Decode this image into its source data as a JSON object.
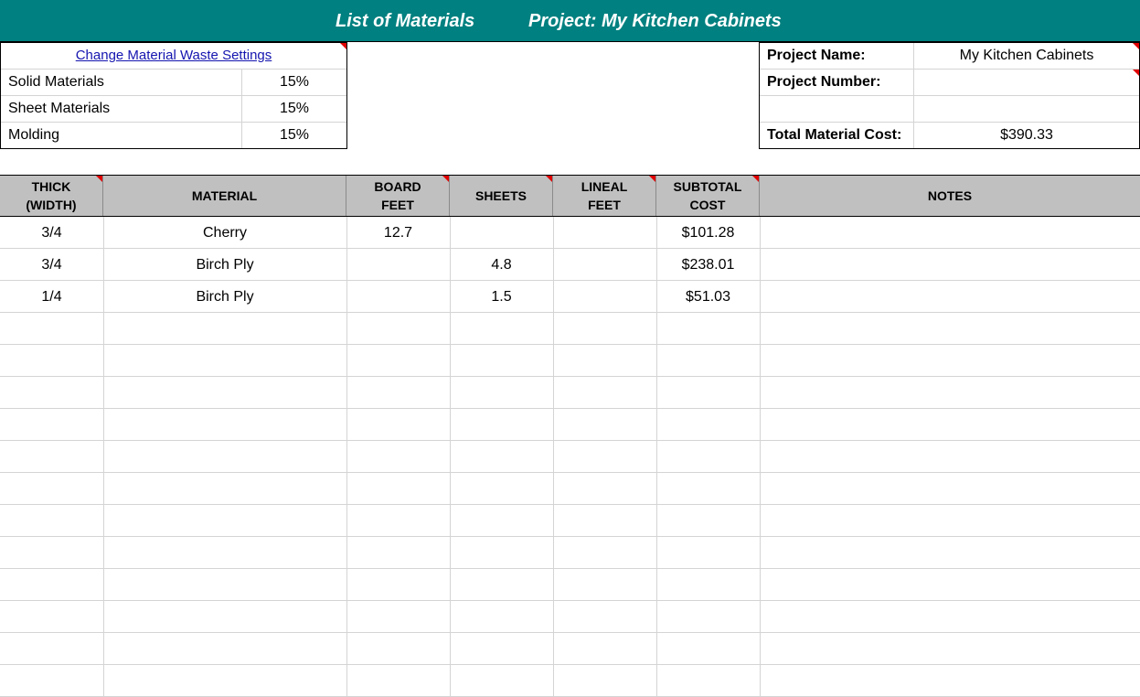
{
  "banner": {
    "title": "List of Materials",
    "project_label": "Project:  My Kitchen Cabinets"
  },
  "waste": {
    "link": "Change Material Waste Settings",
    "rows": [
      {
        "label": "Solid Materials",
        "value": "15%"
      },
      {
        "label": "Sheet Materials",
        "value": "15%"
      },
      {
        "label": "Molding",
        "value": "15%"
      }
    ]
  },
  "project": {
    "name_label": "Project Name:",
    "name_value": "My Kitchen Cabinets",
    "number_label": "Project Number:",
    "number_value": "",
    "blank_label": "",
    "blank_value": "",
    "cost_label": "Total Material Cost:",
    "cost_value": "$390.33"
  },
  "table": {
    "columns": [
      "THICK\n(WIDTH)",
      "MATERIAL",
      "BOARD\nFEET",
      "SHEETS",
      "LINEAL\nFEET",
      "SUBTOTAL\nCOST",
      "NOTES"
    ],
    "rows": [
      [
        "3/4",
        "Cherry",
        "12.7",
        "",
        "",
        "$101.28",
        ""
      ],
      [
        "3/4",
        "Birch Ply",
        "",
        "4.8",
        "",
        "$238.01",
        ""
      ],
      [
        "1/4",
        "Birch Ply",
        "",
        "1.5",
        "",
        "$51.03",
        ""
      ]
    ]
  },
  "colors": {
    "banner": "#008080",
    "header": "#c0c0c0",
    "comment_marker": "#e00000"
  }
}
